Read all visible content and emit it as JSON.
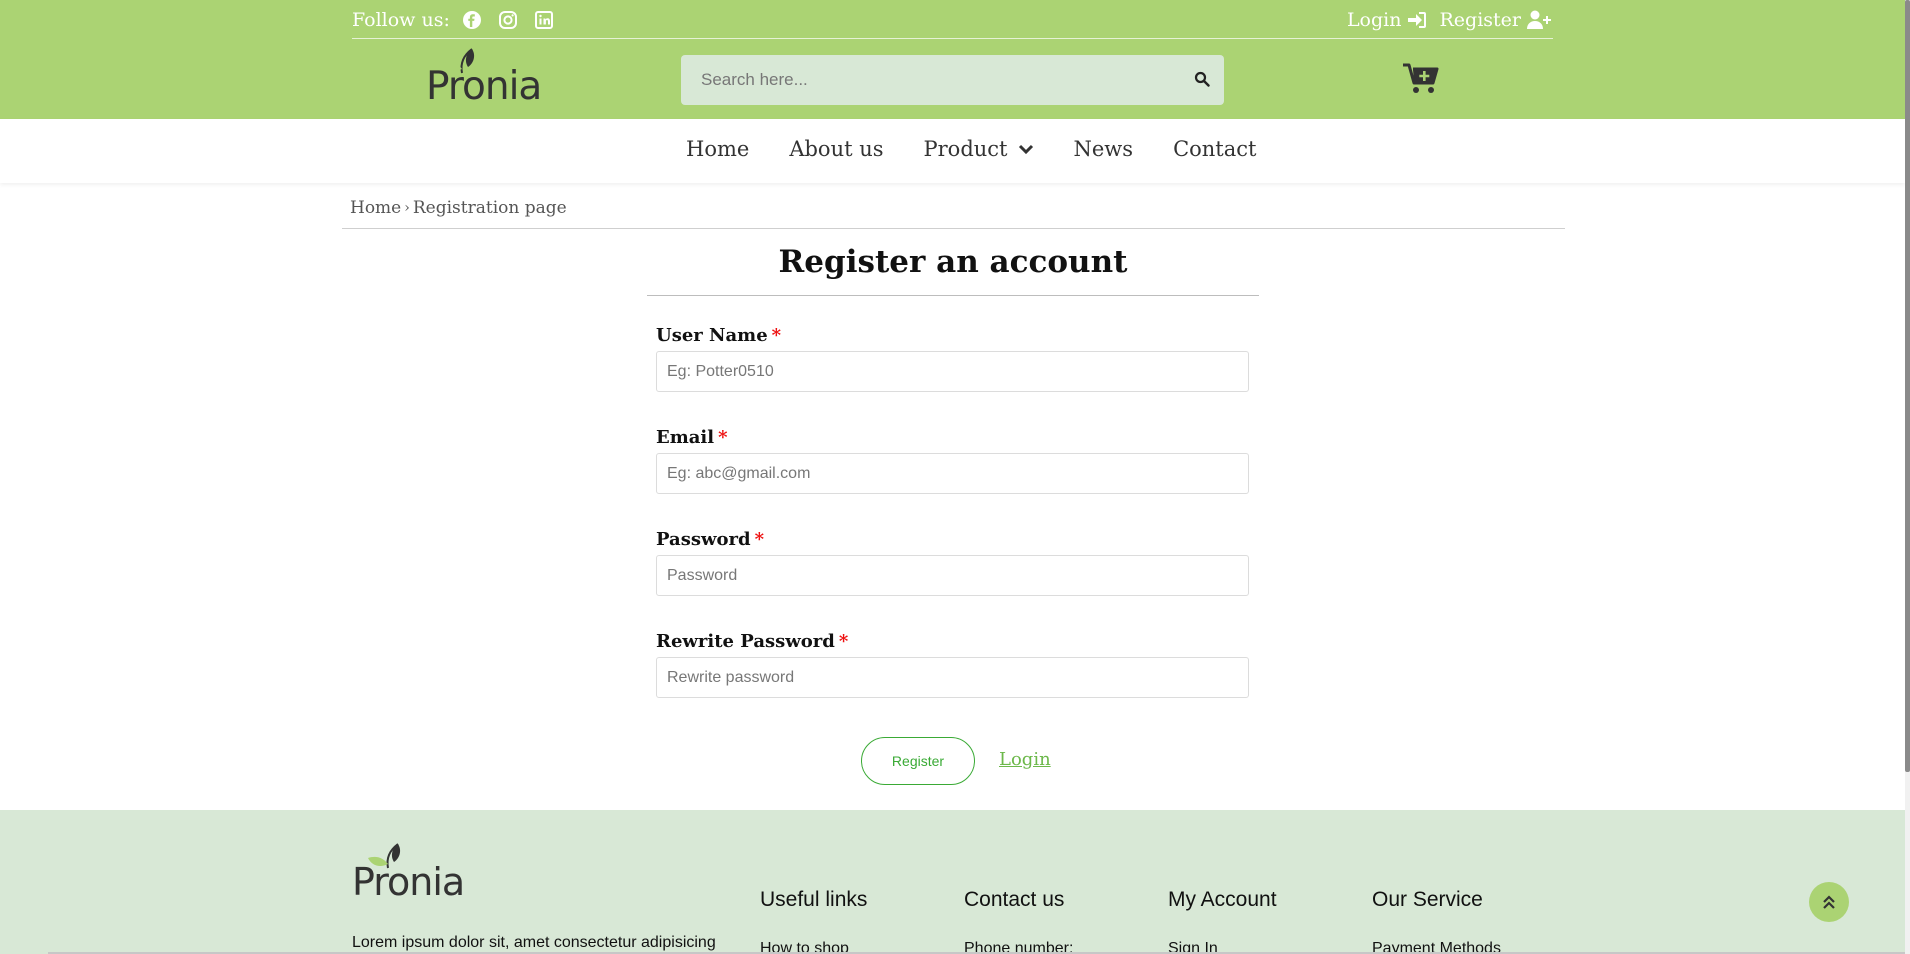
{
  "header": {
    "follow_label": "Follow us:",
    "social_icons": [
      "facebook-icon",
      "instagram-icon",
      "linkedin-icon"
    ],
    "login_label": "Login",
    "register_label": "Register",
    "logo_text": "Pronia",
    "search_placeholder": "Search here...",
    "accent_color": "#abd373"
  },
  "nav": {
    "items": [
      {
        "label": "Home"
      },
      {
        "label": "About us"
      },
      {
        "label": "Product"
      },
      {
        "label": "News"
      },
      {
        "label": "Contact"
      }
    ]
  },
  "breadcrumb": {
    "home": "Home",
    "current": "Registration page"
  },
  "form": {
    "title": "Register an account",
    "fields": [
      {
        "label": "User Name",
        "required_mark": "*",
        "placeholder": "Eg: Potter0510",
        "value": ""
      },
      {
        "label": "Email",
        "required_mark": "*",
        "placeholder": "Eg: abc@gmail.com",
        "value": ""
      },
      {
        "label": "Password",
        "required_mark": "*",
        "placeholder": "Password",
        "value": ""
      },
      {
        "label": "Rewrite Password",
        "required_mark": "*",
        "placeholder": "Rewrite password",
        "value": ""
      }
    ],
    "register_button": "Register",
    "login_link": "Login",
    "button_color": "#3aaa35"
  },
  "footer": {
    "logo_text": "Pronia",
    "about_text": "Lorem ipsum dolor sit, amet consectetur adipisicing",
    "columns": [
      {
        "title": "Useful links",
        "first_link": "How to shop"
      },
      {
        "title": "Contact us",
        "first_link": "Phone number:"
      },
      {
        "title": "My Account",
        "first_link": "Sign In"
      },
      {
        "title": "Our Service",
        "first_link": "Payment Methods"
      }
    ],
    "background": "#d8e8d6"
  }
}
